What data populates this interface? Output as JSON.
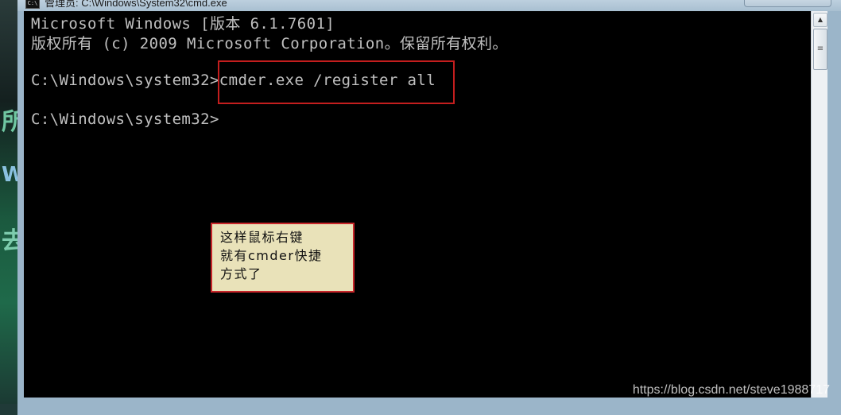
{
  "window": {
    "title": "管理员: C:\\Windows\\System32\\cmd.exe",
    "icon_label": "C:\\"
  },
  "console": {
    "lines": [
      "Microsoft Windows [版本 6.1.7601]",
      "版权所有 (c) 2009 Microsoft Corporation。保留所有权利。",
      "C:\\Windows\\system32>cmder.exe /register all",
      "C:\\Windows\\system32>"
    ]
  },
  "annotation": {
    "lines": [
      "这样鼠标右键",
      "就有cmder快捷",
      "方式了"
    ]
  },
  "desktop": {
    "glyphs": [
      "所",
      "W",
      "去"
    ]
  },
  "scrollbar": {
    "up_arrow": "▲",
    "thumb_grip": "≡"
  },
  "watermark": "https://blog.csdn.net/steve1988717",
  "colors": {
    "console_bg": "#000000",
    "console_text": "#c0c0c0",
    "highlight": "#c41e1e",
    "note_bg": "#e9e2b9"
  }
}
